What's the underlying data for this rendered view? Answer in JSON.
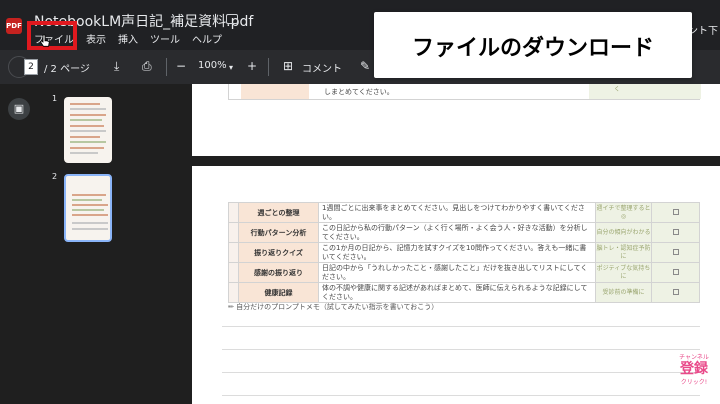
{
  "window": {
    "doc_title": "NotebookLM声日記_補足資料.pdf",
    "right_text": "ント下"
  },
  "menu": [
    "ファイル",
    "表示",
    "挿入",
    "ツール",
    "ヘルプ"
  ],
  "toolbar": {
    "page_current": "2",
    "page_total": "/ 2 ページ",
    "zoom": "100%",
    "comment_label": "コメント"
  },
  "callout": {
    "text": "ファイルのダウンロード"
  },
  "sidebar": {
    "thumbs": [
      "1",
      "2"
    ]
  },
  "page1": {
    "fragment": "しまとめてください。",
    "fragment_right": "く"
  },
  "tasks": [
    {
      "category": "週ごとの整理",
      "description": "1週間ごとに出来事をまとめてください。見出しをつけてわかりやすく書いてください。",
      "note": "週イチで整理すると◎"
    },
    {
      "category": "行動パターン分析",
      "description": "この日記から私の行動パターン（よく行く場所・よく会う人・好きな活動）を分析してください。",
      "note": "自分の傾向がわかる"
    },
    {
      "category": "振り返りクイズ",
      "description": "この1か月の日記から、記憶力を試すクイズを10問作ってください。答えも一緒に書いてください。",
      "note": "脳トレ・認知症予防に"
    },
    {
      "category": "感謝の振り返り",
      "description": "日記の中から「うれしかったこと・感謝したこと」だけを抜き出してリストにしてください。",
      "note": "ポジティブな気持ちに"
    },
    {
      "category": "健康記録",
      "description": "体の不調や健康に関する記述があればまとめて、医師に伝えられるような記録にしてください。",
      "note": "受診前の準備に"
    }
  ],
  "memo": "✏ 自分だけのプロンプトメモ（試してみたい指示を書いておこう）",
  "badge": {
    "top": "チャンネル",
    "main": "登録",
    "bottom": "クリック!"
  },
  "colors": {
    "highlight": "#e0191f",
    "category_bg": "#f9e5d6",
    "note_bg": "#eef2e4"
  }
}
